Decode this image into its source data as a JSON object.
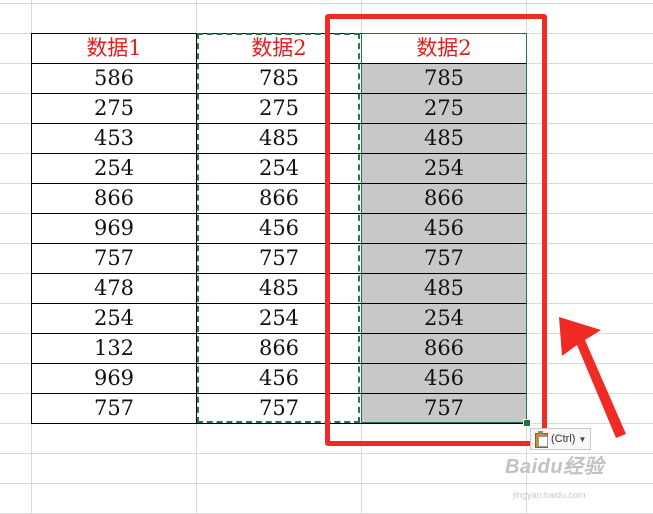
{
  "spreadsheet": {
    "headers": [
      "数据1",
      "数据2",
      "数据2"
    ],
    "rows": [
      [
        "586",
        "785",
        "785"
      ],
      [
        "275",
        "275",
        "275"
      ],
      [
        "453",
        "485",
        "485"
      ],
      [
        "254",
        "254",
        "254"
      ],
      [
        "866",
        "866",
        "866"
      ],
      [
        "969",
        "456",
        "456"
      ],
      [
        "757",
        "757",
        "757"
      ],
      [
        "478",
        "485",
        "485"
      ],
      [
        "254",
        "254",
        "254"
      ],
      [
        "132",
        "866",
        "866"
      ],
      [
        "969",
        "456",
        "456"
      ],
      [
        "757",
        "757",
        "757"
      ]
    ]
  },
  "paste_options": {
    "label": "(Ctrl)",
    "icon": "clipboard-paste-icon"
  },
  "watermark": {
    "text": "Baidu经验",
    "url_text": "jingyan.baidu.com"
  },
  "colors": {
    "header_text": "#e0201a",
    "highlight_frame": "#f02a24",
    "selection_fill": "#c8c8c8",
    "marquee": "#1f7a47"
  }
}
